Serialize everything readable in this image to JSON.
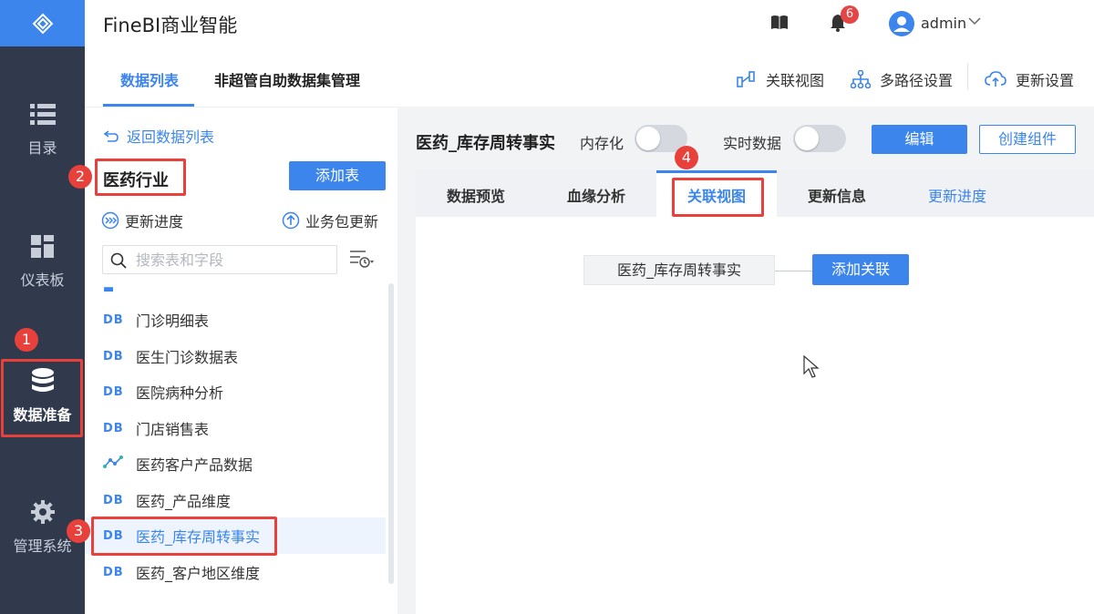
{
  "app": {
    "title": "FineBI商业智能"
  },
  "header": {
    "notification_count": "6",
    "user_name": "admin"
  },
  "left_nav": {
    "items": [
      {
        "label": "目录",
        "icon": "list-icon"
      },
      {
        "label": "仪表板",
        "icon": "dashboard-icon"
      },
      {
        "label": "数据准备",
        "icon": "database-icon",
        "active": true
      },
      {
        "label": "管理系统",
        "icon": "gear-icon"
      }
    ]
  },
  "sub_tabs": [
    {
      "label": "数据列表",
      "active": true
    },
    {
      "label": "非超管自助数据集管理"
    }
  ],
  "sub_tools": [
    {
      "label": "关联视图",
      "icon": "relation-view-icon"
    },
    {
      "label": "多路径设置",
      "icon": "multi-path-icon"
    },
    {
      "label": "更新设置",
      "icon": "cloud-update-icon"
    }
  ],
  "panel": {
    "back_label": "返回数据列表",
    "package_title": "医药行业",
    "add_table_label": "添加表",
    "update_progress_label": "更新进度",
    "package_update_label": "业务包更新",
    "search_placeholder": "搜索表和字段",
    "db_badge": "DB",
    "items": [
      {
        "label": "门诊明细表",
        "type": "db"
      },
      {
        "label": "医生门诊数据表",
        "type": "db"
      },
      {
        "label": "医院病种分析",
        "type": "db"
      },
      {
        "label": "门店销售表",
        "type": "db"
      },
      {
        "label": "医药客户产品数据",
        "type": "self-service"
      },
      {
        "label": "医药_产品维度",
        "type": "db"
      },
      {
        "label": "医药_库存周转事实",
        "type": "db",
        "selected": true
      },
      {
        "label": "医药_客户地区维度",
        "type": "db"
      }
    ]
  },
  "main": {
    "table_title": "医药_库存周转事实",
    "in_memory_label": "内存化",
    "in_memory_on": false,
    "realtime_label": "实时数据",
    "realtime_on": false,
    "edit_label": "编辑",
    "create_component_label": "创建组件",
    "tabs": [
      {
        "label": "数据预览"
      },
      {
        "label": "血缘分析"
      },
      {
        "label": "关联视图",
        "active": true
      },
      {
        "label": "更新信息"
      },
      {
        "label": "更新进度",
        "link": true
      }
    ],
    "relation": {
      "table_label": "医药_库存周转事实",
      "add_label": "添加关联"
    }
  },
  "annotations": [
    "1",
    "2",
    "3",
    "4"
  ],
  "colors": {
    "accent": "#3b85ec",
    "nav_bg": "#313a4d",
    "annotation": "#e8403a",
    "badge": "#e54545"
  }
}
